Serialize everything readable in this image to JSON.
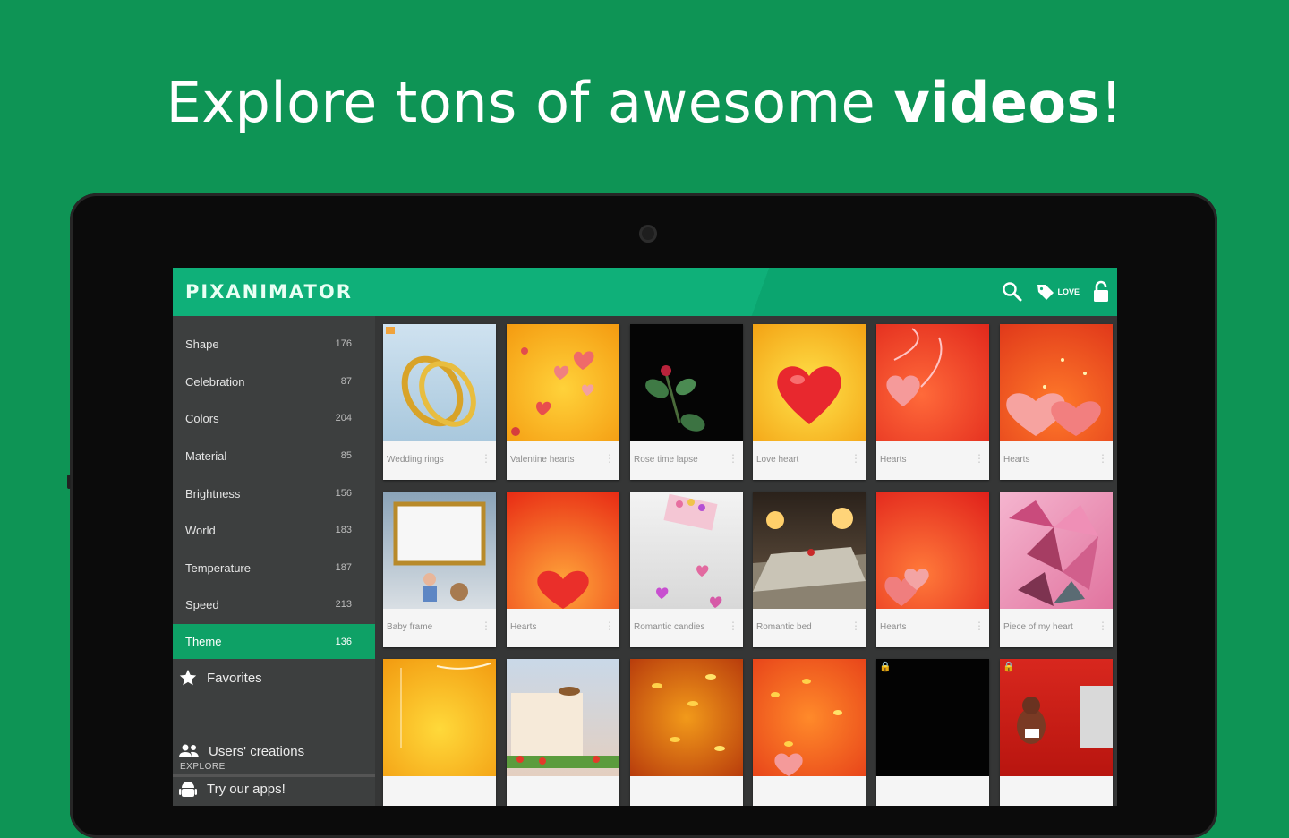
{
  "promo": {
    "headline_prefix": "Explore tons of awesome ",
    "headline_bold": "videos",
    "headline_suffix": "!"
  },
  "app": {
    "title": "PIXANIMATOR",
    "accent_color": "#0fb079",
    "background_color": "#0e9455",
    "love_label": "LOVE",
    "icons": [
      "search-icon",
      "tag-icon",
      "lock-icon"
    ]
  },
  "categories": [
    {
      "label": "Shape",
      "count": "176"
    },
    {
      "label": "Celebration",
      "count": "87"
    },
    {
      "label": "Colors",
      "count": "204"
    },
    {
      "label": "Material",
      "count": "85"
    },
    {
      "label": "Brightness",
      "count": "156"
    },
    {
      "label": "World",
      "count": "183"
    },
    {
      "label": "Temperature",
      "count": "187"
    },
    {
      "label": "Speed",
      "count": "213"
    },
    {
      "label": "Theme",
      "count": "136",
      "active": true
    }
  ],
  "menu": {
    "favorites": "Favorites",
    "explore_label": "EXPLORE",
    "users_creations": "Users' creations",
    "try_apps": "Try our apps!"
  },
  "videos": [
    {
      "title": "Wedding rings"
    },
    {
      "title": "Valentine hearts"
    },
    {
      "title": "Rose time lapse"
    },
    {
      "title": "Love heart"
    },
    {
      "title": "Hearts"
    },
    {
      "title": "Hearts"
    },
    {
      "title": "Baby frame"
    },
    {
      "title": "Hearts"
    },
    {
      "title": "Romantic candies"
    },
    {
      "title": "Romantic bed"
    },
    {
      "title": "Hearts"
    },
    {
      "title": "Piece of my heart"
    },
    {
      "title": ""
    },
    {
      "title": ""
    },
    {
      "title": ""
    },
    {
      "title": ""
    },
    {
      "title": ""
    },
    {
      "title": ""
    }
  ]
}
